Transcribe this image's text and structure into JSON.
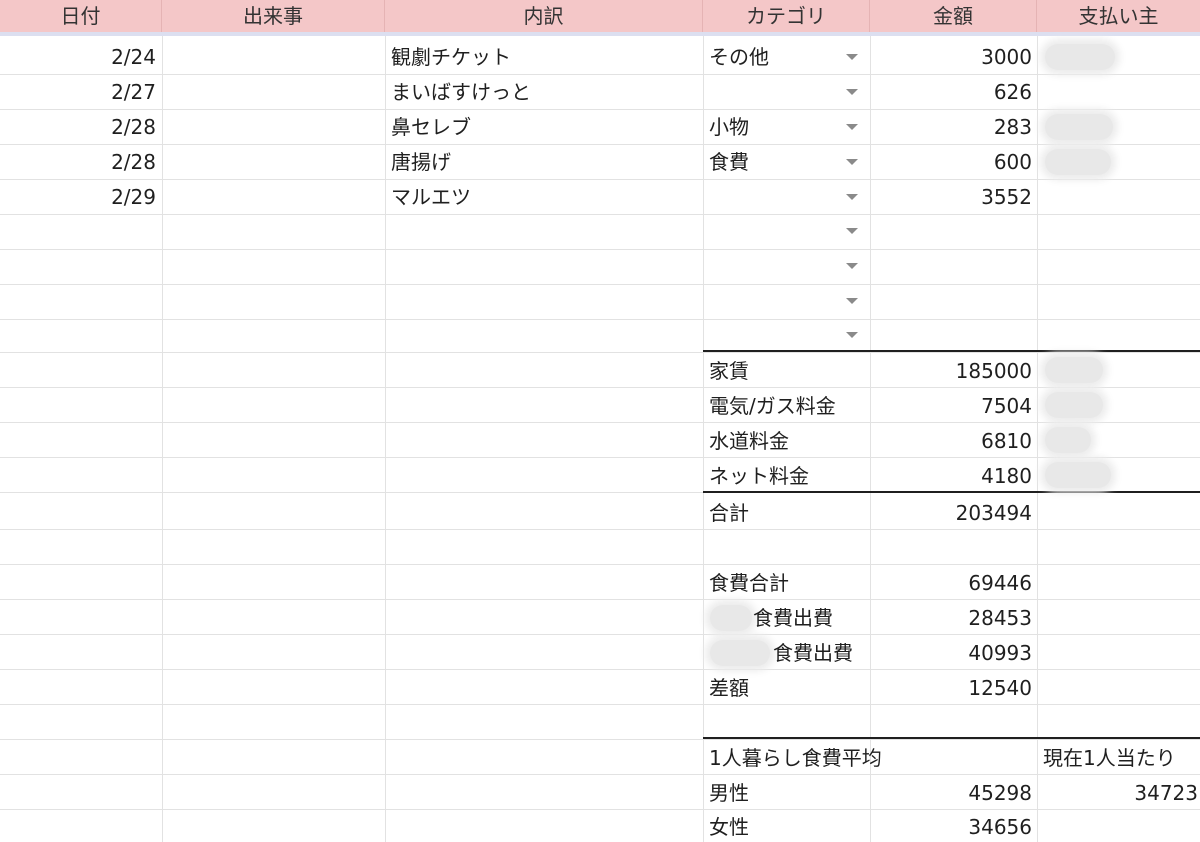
{
  "headers": [
    "日付",
    "出来事",
    "内訳",
    "カテゴリ",
    "金額",
    "支払い主"
  ],
  "rows": [
    {
      "date": "2/24",
      "event": "",
      "detail": "観劇チケット",
      "category": "その他",
      "amount": "3000"
    },
    {
      "date": "2/27",
      "event": "",
      "detail": "まいばすけっと",
      "category": "",
      "amount": "626"
    },
    {
      "date": "2/28",
      "event": "",
      "detail": "鼻セレブ",
      "category": "小物",
      "amount": "283"
    },
    {
      "date": "2/28",
      "event": "",
      "detail": "唐揚げ",
      "category": "食費",
      "amount": "600"
    },
    {
      "date": "2/29",
      "event": "",
      "detail": "マルエツ",
      "category": "",
      "amount": "3552"
    }
  ],
  "fixed_costs": [
    {
      "label": "家賃",
      "amount": "185000"
    },
    {
      "label": "電気/ガス料金",
      "amount": "7504"
    },
    {
      "label": "水道料金",
      "amount": "6810"
    },
    {
      "label": "ネット料金",
      "amount": "4180"
    }
  ],
  "total": {
    "label": "合計",
    "amount": "203494"
  },
  "food": {
    "total_label": "食費合計",
    "total_amount": "69446",
    "person_a_label": "食費出費",
    "person_a_amount": "28453",
    "person_b_label": "食費出費",
    "person_b_amount": "40993",
    "diff_label": "差額",
    "diff_amount": "12540"
  },
  "average": {
    "title": "1人暮らし食費平均",
    "current_label": "現在1人当たり",
    "male_label": "男性",
    "male_amount": "45298",
    "current_value": "34723",
    "female_label": "女性",
    "female_amount": "34656"
  }
}
